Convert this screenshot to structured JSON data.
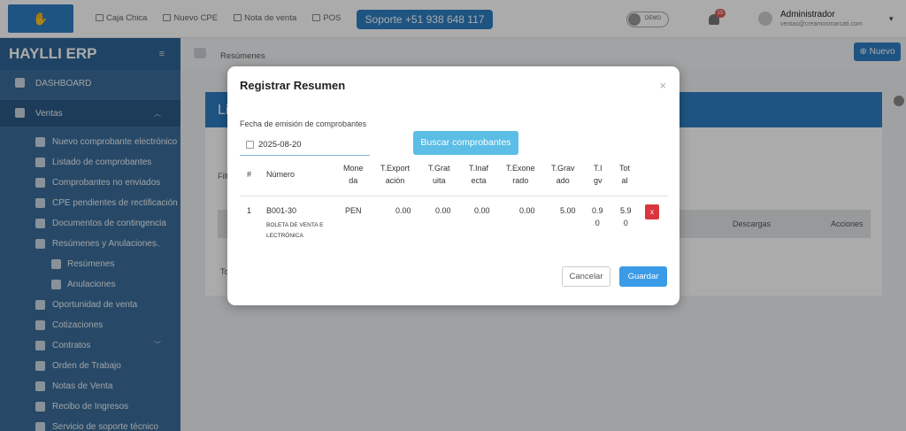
{
  "topbar": {
    "links": [
      "Caja Chica",
      "Nuevo CPE",
      "Nota de venta",
      "POS"
    ],
    "support_label": "Soporte +51 938 648 117",
    "toggle_label": "DEMO",
    "notifications_count": "15",
    "user_name": "Administrador",
    "user_email": "ventas@creamosmarcati.com"
  },
  "sidebar": {
    "brand": "HAYLLI ERP",
    "items": [
      {
        "label": "DASHBOARD",
        "icon": "dashboard-icon"
      },
      {
        "label": "Ventas",
        "icon": "handshake-icon"
      },
      {
        "label": "Nuevo comprobante electrónico",
        "icon": "file-icon"
      },
      {
        "label": "Listado de comprobantes",
        "icon": "list-icon"
      },
      {
        "label": "Comprobantes no enviados",
        "icon": "archive-icon"
      },
      {
        "label": "CPE pendientes de rectificación",
        "icon": "warning-icon"
      },
      {
        "label": "Documentos de contingencia",
        "icon": "document-icon"
      },
      {
        "label": "Resúmenes y Anulaciones",
        "icon": "info-icon"
      },
      {
        "label": "Resúmenes",
        "icon": "list-icon"
      },
      {
        "label": "Anulaciones",
        "icon": "ban-icon"
      },
      {
        "label": "Oportunidad de venta",
        "icon": "bulb-icon"
      },
      {
        "label": "Cotizaciones",
        "icon": "hand-coin-icon"
      },
      {
        "label": "Contratos",
        "icon": "signature-icon"
      },
      {
        "label": "Orden de Trabajo",
        "icon": "file-icon"
      },
      {
        "label": "Notas de Venta",
        "icon": "note-icon"
      },
      {
        "label": "Recibo de Ingresos",
        "icon": "receipt-icon"
      },
      {
        "label": "Servicio de soporte técnico",
        "icon": "support-icon"
      }
    ]
  },
  "page": {
    "breadcrumb": "Resúmenes",
    "new_button": "Nuevo",
    "card_title": "Li",
    "filter_label": "Filt",
    "col_downloads": "Descargas",
    "col_actions": "Acciones",
    "total_label": "To"
  },
  "modal": {
    "title": "Registrar Resumen",
    "close": "×",
    "date_label": "Fecha de emisión de comprobantes",
    "date_value": "2025-08-20",
    "search_button": "Buscar comprobantes",
    "columns": [
      "#",
      "Número",
      "Mone\nda",
      "T.Export\nación",
      "T.Grat\nuita",
      "T.Inaf\necta",
      "T.Exone\nrado",
      "T.Grav\nado",
      "T.I\ngv",
      "Tot\nal"
    ],
    "row": {
      "index": "1",
      "numero": "B001-30",
      "descripcion": "BOLETA DE VENTA E\nLECTRÓNICA",
      "moneda": "PEN",
      "exportacion": "0.00",
      "gratuita": "0.00",
      "inafecta": "0.00",
      "exonerado": "0.00",
      "gravado": "5.00",
      "igv": "0.9\n0",
      "total": "5.9\n0",
      "delete_label": "x"
    },
    "cancel_button": "Cancelar",
    "save_button": "Guardar"
  }
}
